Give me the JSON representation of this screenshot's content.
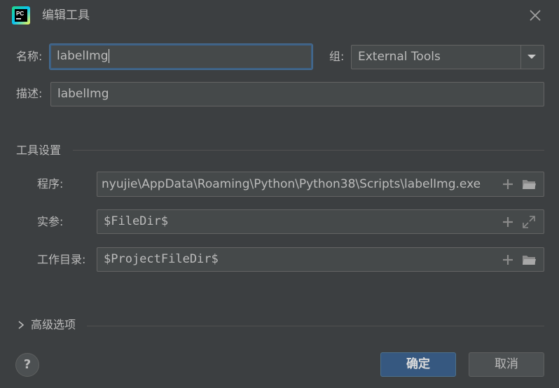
{
  "window": {
    "title": "编辑工具",
    "app_icon": "pycharm-icon",
    "close_icon": "close-icon"
  },
  "form": {
    "name_label": "名称:",
    "name_value": "labelImg",
    "group_label": "组:",
    "group_value": "External Tools",
    "description_label": "描述:",
    "description_value": "labelImg"
  },
  "tool_settings": {
    "header": "工具设置",
    "program_label": "程序:",
    "program_value": "nyujie\\AppData\\Roaming\\Python\\Python38\\Scripts\\labelImg.exe",
    "arguments_label": "实参:",
    "arguments_value": "$FileDir$",
    "working_dir_label": "工作目录:",
    "working_dir_value": "$ProjectFileDir$"
  },
  "advanced": {
    "label": "高级选项"
  },
  "buttons": {
    "help": "?",
    "ok": "确定",
    "cancel": "取消"
  },
  "colors": {
    "background": "#3c3f41",
    "field": "#45494a",
    "accent": "#365880",
    "focus": "#3d6185"
  }
}
